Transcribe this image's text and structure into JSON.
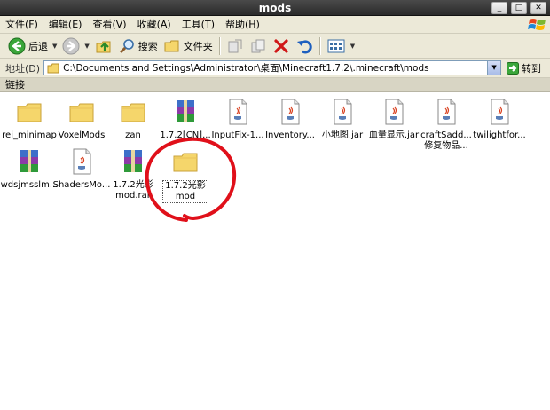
{
  "window": {
    "title": "mods",
    "minimize": "_",
    "maximize": "□",
    "close": "✕"
  },
  "menu": [
    "文件(F)",
    "编辑(E)",
    "查看(V)",
    "收藏(A)",
    "工具(T)",
    "帮助(H)"
  ],
  "toolbar": {
    "back_label": "后退",
    "search_label": "搜索",
    "folders_label": "文件夹"
  },
  "address": {
    "label": "地址(D)",
    "path": "C:\\Documents and Settings\\Administrator\\桌面\\Minecraft1.7.2\\.minecraft\\mods",
    "go_label": "转到"
  },
  "links": {
    "label": "链接"
  },
  "files": [
    {
      "name": "rei_minimap",
      "type": "folder"
    },
    {
      "name": "VoxelMods",
      "type": "folder"
    },
    {
      "name": "zan",
      "type": "folder"
    },
    {
      "name": "1.7.2[CN]...",
      "type": "rar"
    },
    {
      "name": "InputFix-1...",
      "type": "jar"
    },
    {
      "name": "Inventory...",
      "type": "jar"
    },
    {
      "name": "小地图.jar",
      "type": "jar"
    },
    {
      "name": "血量显示.jar",
      "type": "jar"
    },
    {
      "name": "craftSadd...\n修复物品...",
      "type": "jar"
    },
    {
      "name": "twilightfor...",
      "type": "jar"
    },
    {
      "name": "wdsjmsslm...",
      "type": "rar"
    },
    {
      "name": "ShadersMo...",
      "type": "jar"
    },
    {
      "name": "1.7.2光影\nmod.rar",
      "type": "rar"
    },
    {
      "name": "1.7.2光影\nmod",
      "type": "folder",
      "selected": true
    }
  ],
  "colors": {
    "folder": "#f5d66b",
    "accent_red": "#e0101a"
  }
}
